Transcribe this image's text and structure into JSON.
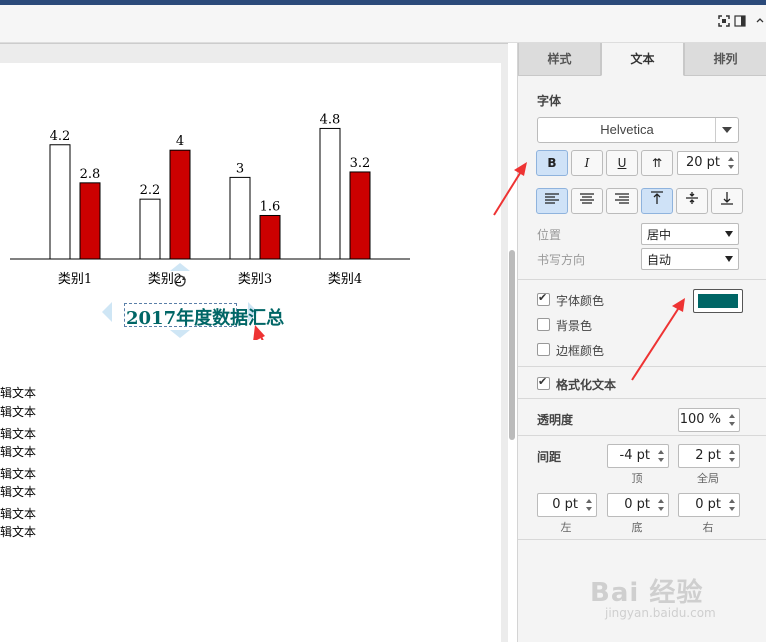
{
  "toolbar": {
    "icons": [
      "fullscreen-icon",
      "panel-toggle-icon",
      "chevron-icon"
    ]
  },
  "chart_data": {
    "type": "bar",
    "categories": [
      "类别1",
      "类别2",
      "类别3",
      "类别4"
    ],
    "series": [
      {
        "values": [
          4.2,
          2.2,
          3,
          4.8
        ],
        "color": "#ffffff"
      },
      {
        "values": [
          2.8,
          4,
          1.6,
          3.2
        ],
        "color": "#cc0000"
      }
    ],
    "ylim": [
      0,
      5
    ],
    "data_labels": true,
    "grid": false,
    "title": "2017年度数据汇总",
    "title_color": "#006666"
  },
  "canvas": {
    "edit_texts": [
      "辑文本",
      "辑文本",
      "辑文本",
      "辑文本",
      "辑文本",
      "辑文本",
      "辑文本",
      "辑文本"
    ]
  },
  "panel": {
    "tabs": [
      {
        "label": "样式",
        "active": false
      },
      {
        "label": "文本",
        "active": true
      },
      {
        "label": "排列",
        "active": false
      }
    ],
    "font_label": "字体",
    "font_value": "Helvetica",
    "buttons": {
      "bold": "B",
      "italic": "I",
      "underline": "U",
      "vertical": "⇈"
    },
    "font_size": "20 pt",
    "position_label": "位置",
    "position_value": "居中",
    "writing_dir_label": "书写方向",
    "writing_dir_value": "自动",
    "font_color_label": "字体颜色",
    "font_color_checked": true,
    "font_color": "#006666",
    "bg_color_label": "背景色",
    "bg_color_checked": false,
    "border_color_label": "边框颜色",
    "border_color_checked": false,
    "formatted_text_label": "格式化文本",
    "formatted_text_checked": true,
    "opacity_label": "透明度",
    "opacity_value": "100 %",
    "spacing_label": "间距",
    "spacing_top": "-4 pt",
    "spacing_top_label": "顶",
    "spacing_global": "2 pt",
    "spacing_global_label": "全局",
    "spacing_left": "0 pt",
    "spacing_left_label": "左",
    "spacing_bottom": "0 pt",
    "spacing_bottom_label": "底",
    "spacing_right": "0 pt",
    "spacing_right_label": "右"
  },
  "watermark": {
    "main": "Bai 经验",
    "sub": "jingyan.baidu.com"
  },
  "colors": {
    "accent": "#2b4a7a",
    "highlight": "#cfe2f7",
    "arrow": "#ee3333"
  }
}
